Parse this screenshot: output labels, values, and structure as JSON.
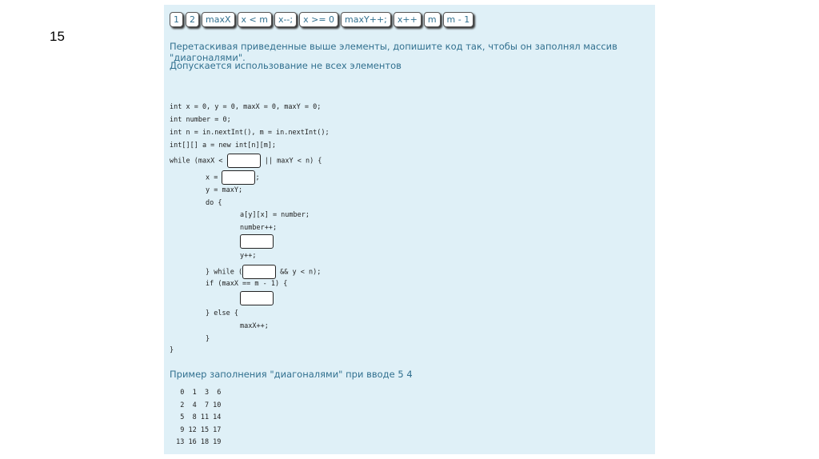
{
  "slide_number": "15",
  "chips": [
    "1",
    "2",
    "maxX",
    "x < m",
    "x--;",
    "x >= 0",
    "maxY++;",
    "x++",
    "m",
    "m - 1"
  ],
  "instruction": "Перетаскивая приведенные выше элементы, допишите код так, чтобы он заполнял массив \"диагоналями\".",
  "note": "Допускается использование не всех элементов",
  "code": {
    "l1": "int x = 0, y = 0, maxX = 0, maxY = 0;",
    "l2": "int number = 0;",
    "l3": "int n = in.nextInt(), m = in.nextInt();",
    "l4": "int[][] a = new int[n][m];",
    "l5a": "while (maxX < ",
    "l5b": " || maxY < n) {",
    "l6a": "x = ",
    "l6b": ";",
    "l7": "y = maxY;",
    "l8": "do {",
    "l9": "a[y][x] = number;",
    "l10": "number++;",
    "l12": "y++;",
    "l13a": "} while (",
    "l13b": " && y < n);",
    "l14": "if (maxX == m - 1) {",
    "l16": "} else {",
    "l17": "maxX++;",
    "l18": "}",
    "l19": "}"
  },
  "example_label": "Пример заполнения \"диагоналями\" при вводе 5 4",
  "matrix": [
    "  0  1  3  6",
    "  2  4  7 10",
    "  5  8 11 14",
    "  9 12 15 17",
    " 13 16 18 19"
  ]
}
